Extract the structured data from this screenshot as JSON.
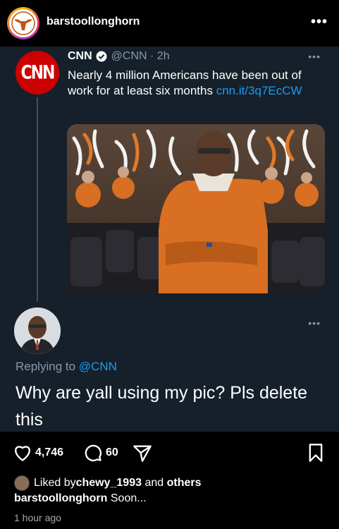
{
  "header": {
    "username": "barstoollonghorn",
    "more_glyph": "•••"
  },
  "tweet": {
    "logo_text": "CNN",
    "name": "CNN",
    "handle_time": "@CNN · 2h",
    "more_glyph": "•••",
    "text": "Nearly 4 million Americans have been out of work for at least six months ",
    "link": "cnn.it/3q7EcCW"
  },
  "reply": {
    "more_glyph": "•••",
    "replying_prefix": "Replying to ",
    "replying_handle": "@CNN",
    "text": "Why are yall using my pic? Pls delete this"
  },
  "actions": {
    "likes": "4,746",
    "comments": "60"
  },
  "meta": {
    "liked_prefix": "Liked by ",
    "liked_user": "chewy_1993",
    "liked_and": " and ",
    "liked_others": "others",
    "caption_user": "barstoollonghorn",
    "caption_text": " Soon...",
    "time": "1 hour ago"
  },
  "colors": {
    "background": "#15202b",
    "link": "#1d9bf0",
    "cnn_red": "#cc0000",
    "texas_orange": "#d86f22"
  }
}
